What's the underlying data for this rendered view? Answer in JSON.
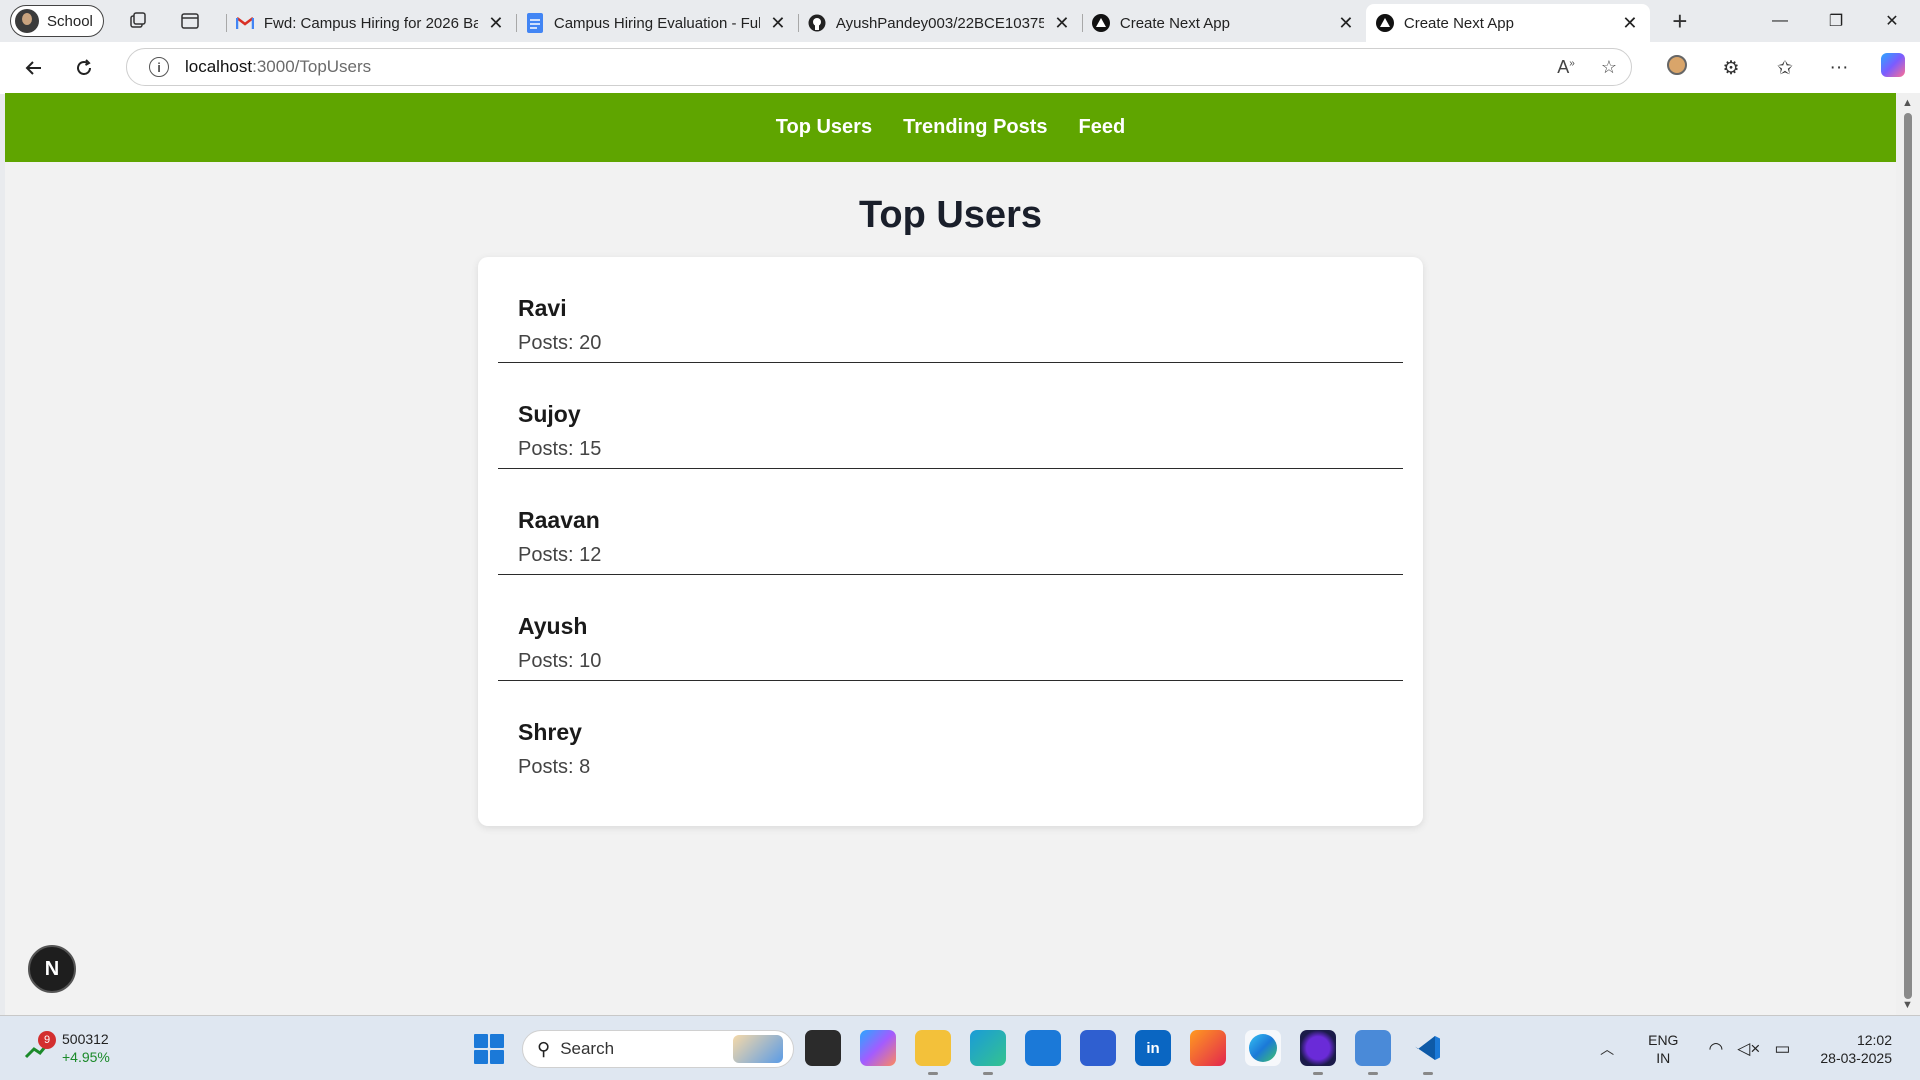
{
  "browser": {
    "profile_label": "School",
    "tabs": [
      {
        "title": "Fwd: Campus Hiring for 2026 Ba",
        "favicon": "gmail-icon"
      },
      {
        "title": "Campus Hiring Evaluation - Full",
        "favicon": "docs-icon"
      },
      {
        "title": "AyushPandey003/22BCE10375",
        "favicon": "github-icon"
      },
      {
        "title": "Create Next App",
        "favicon": "nextjs-icon"
      },
      {
        "title": "Create Next App",
        "favicon": "nextjs-icon",
        "active": true
      }
    ],
    "url_host": "localhost",
    "url_path": ":3000/TopUsers"
  },
  "page": {
    "nav": {
      "items": [
        "Top Users",
        "Trending Posts",
        "Feed"
      ]
    },
    "title": "Top Users",
    "posts_prefix": "Posts: ",
    "users": [
      {
        "name": "Ravi",
        "posts": 20
      },
      {
        "name": "Sujoy",
        "posts": 15
      },
      {
        "name": "Raavan",
        "posts": 12
      },
      {
        "name": "Ayush",
        "posts": 10
      },
      {
        "name": "Shrey",
        "posts": 8
      }
    ],
    "dev_badge": "N"
  },
  "taskbar": {
    "stock": {
      "badge": "9",
      "value": "500312",
      "change": "+4.95%"
    },
    "search_label": "Search",
    "lang": {
      "line1": "ENG",
      "line2": "IN"
    },
    "clock": {
      "time": "12:02",
      "date": "28-03-2025"
    }
  },
  "colors": {
    "nav_green": "#5fa500",
    "accent_blue": "#1b79d8"
  }
}
